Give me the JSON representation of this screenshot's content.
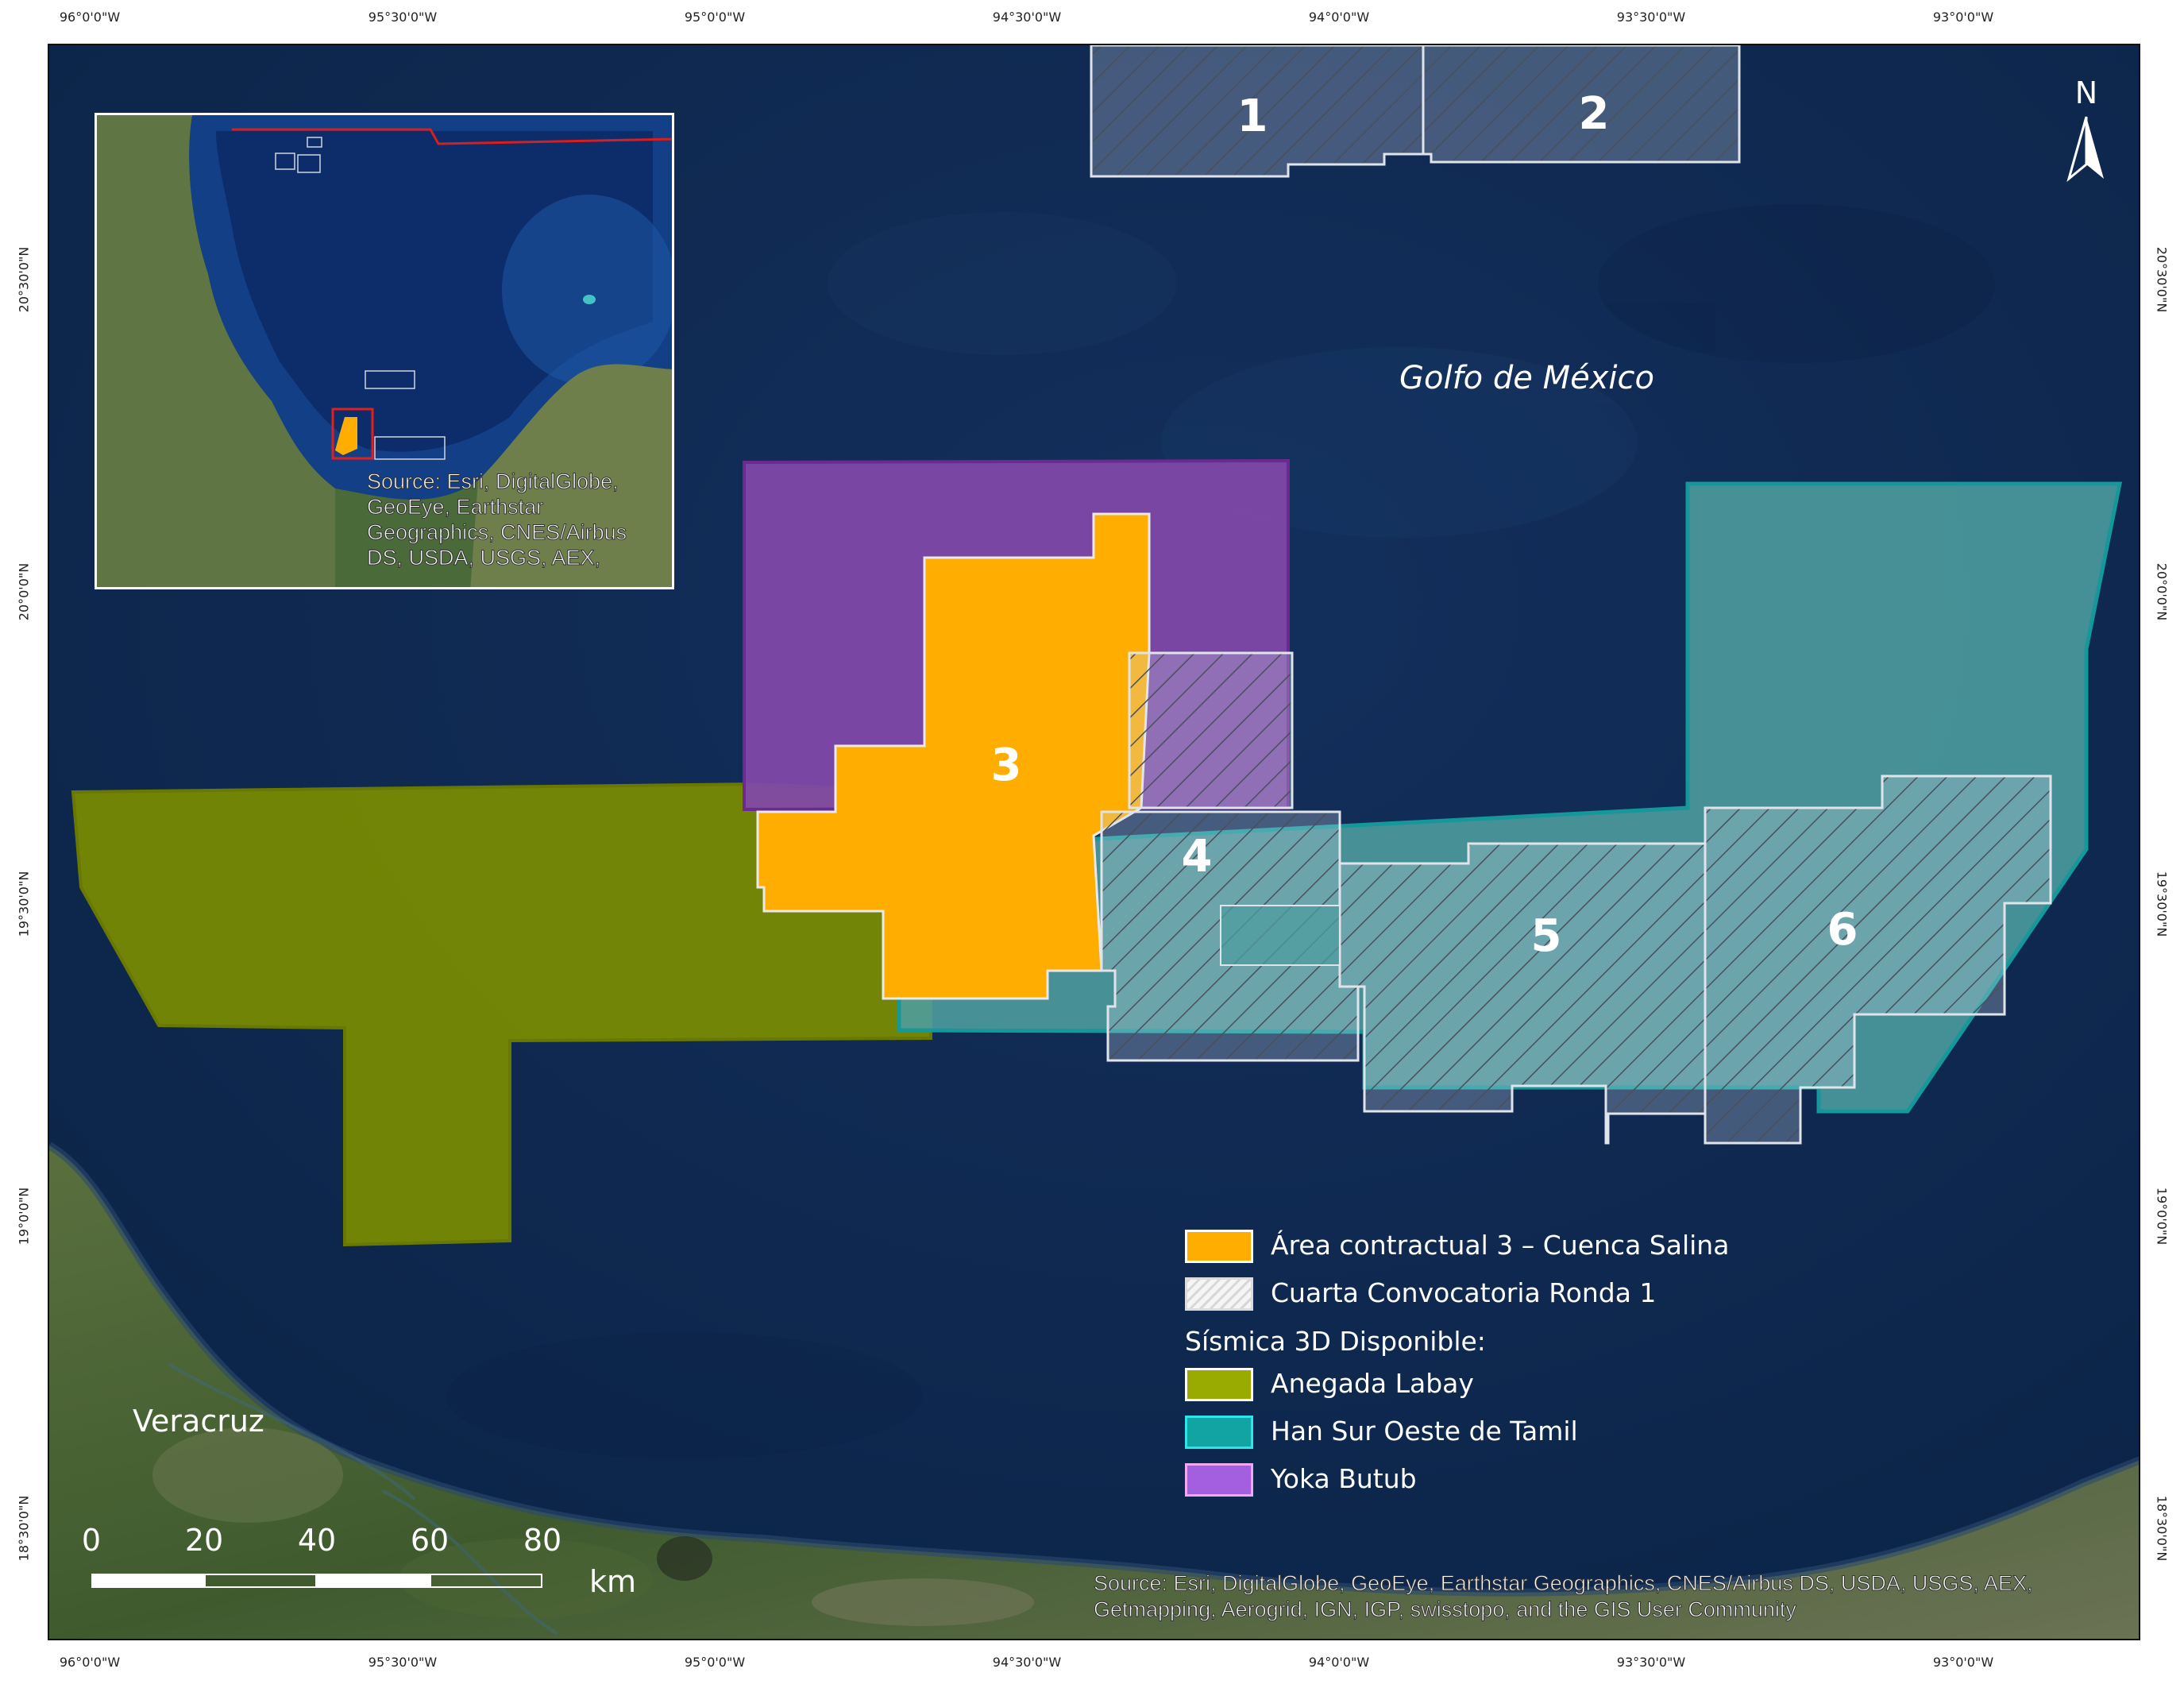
{
  "graticule": {
    "top": [
      "96°0'0\"W",
      "95°30'0\"W",
      "95°0'0\"W",
      "94°30'0\"W",
      "94°0'0\"W",
      "93°30'0\"W",
      "93°0'0\"W"
    ],
    "bottom": [
      "96°0'0\"W",
      "95°30'0\"W",
      "95°0'0\"W",
      "94°30'0\"W",
      "94°0'0\"W",
      "93°30'0\"W",
      "93°0'0\"W"
    ],
    "left": [
      "20°30'0\"N",
      "20°0'0\"N",
      "19°30'0\"N",
      "19°0'0\"N",
      "18°30'0\"N"
    ],
    "right": [
      "20°30'0\"N",
      "20°0'0\"N",
      "19°30'0\"N",
      "19°0'0\"N",
      "18°30'0\"N"
    ]
  },
  "map": {
    "water_label": "Golfo de México",
    "land_label": "Veracruz",
    "area_numbers": [
      "1",
      "2",
      "3",
      "4",
      "5",
      "6"
    ],
    "north_arrow": "N",
    "source": "Source: Esri, DigitalGlobe, GeoEye, Earthstar Geographics, CNES/Airbus DS, USDA, USGS, AEX, Getmapping, Aerogrid, IGN, IGP, swisstopo, and the GIS User Community"
  },
  "inset": {
    "source": "Source: Esri, DigitalGlobe, GeoEye, Earthstar Geographics, CNES/Airbus DS, USDA, USGS, AEX,"
  },
  "legend": {
    "items": [
      {
        "label": "Área contractual 3 – Cuenca Salina",
        "color": "#ffad00"
      },
      {
        "label": "Cuarta Convocatoria Ronda 1",
        "pattern": "diagonal-hatch"
      }
    ],
    "section_title": "Sísmica 3D Disponible:",
    "seismic_items": [
      {
        "label": "Anegada Labay",
        "color": "#9aab00"
      },
      {
        "label": "Han Sur Oeste de Tamil",
        "color": "#12a3a3"
      },
      {
        "label": "Yoka Butub",
        "color": "#a35fe0"
      }
    ]
  },
  "scale_bar": {
    "ticks": [
      "0",
      "20",
      "40",
      "60",
      "80"
    ],
    "unit": "km"
  },
  "colors": {
    "ocean": "#0e2a52",
    "land": "#3f5a2c",
    "area3": "#ffad00",
    "anegada": "#7a8c00",
    "han": "#4d9e9f",
    "yoka": "#8048a8"
  }
}
